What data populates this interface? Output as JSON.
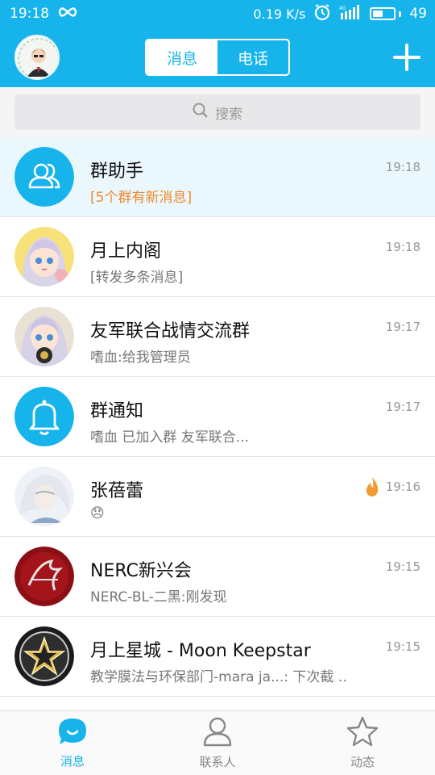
{
  "status": {
    "time": "19:18",
    "speed": "0.19 K/s",
    "battery": "49",
    "battery_level": 0.49
  },
  "header": {
    "tabs": [
      "消息",
      "电话"
    ],
    "active_tab": 0
  },
  "search": {
    "placeholder": "搜索"
  },
  "conversations": [
    {
      "name": "群助手",
      "subtitle": "[5个群有新消息]",
      "time": "19:18",
      "highlight": true,
      "avatar": "group-assistant-icon",
      "subtitle_color": "#f08a2a"
    },
    {
      "name": "月上内阁",
      "subtitle": "[转发多条消息]",
      "time": "19:18",
      "avatar": "anime-girl-avatar"
    },
    {
      "name": "友军联合战情交流群",
      "subtitle": "嗜血:给我管理员",
      "time": "19:17",
      "avatar": "anime-girl-avatar-2"
    },
    {
      "name": "群通知",
      "subtitle": "嗜血 已加入群 友军联合...",
      "time": "19:17",
      "avatar": "bell-icon"
    },
    {
      "name": "张蓓蕾",
      "subtitle": "😞",
      "time": "19:16",
      "avatar": "anime-white-hair-avatar",
      "badge": "flame-icon"
    },
    {
      "name": "NERC新兴会",
      "subtitle": "NERC-BL-二黑:刚发现",
      "time": "19:15",
      "avatar": "nerc-logo"
    },
    {
      "name": "月上星城 - Moon Keepstar",
      "subtitle": "教学膜法与环保部门-mara ja...: 下次截 ‥",
      "time": "19:15",
      "avatar": "star-emblem"
    }
  ],
  "tabbar": {
    "items": [
      "消息",
      "联系人",
      "动态"
    ],
    "active": 0
  },
  "colors": {
    "accent": "#17b4ec",
    "highlight_row": "#eaf7fd",
    "orange": "#f08a2a"
  }
}
